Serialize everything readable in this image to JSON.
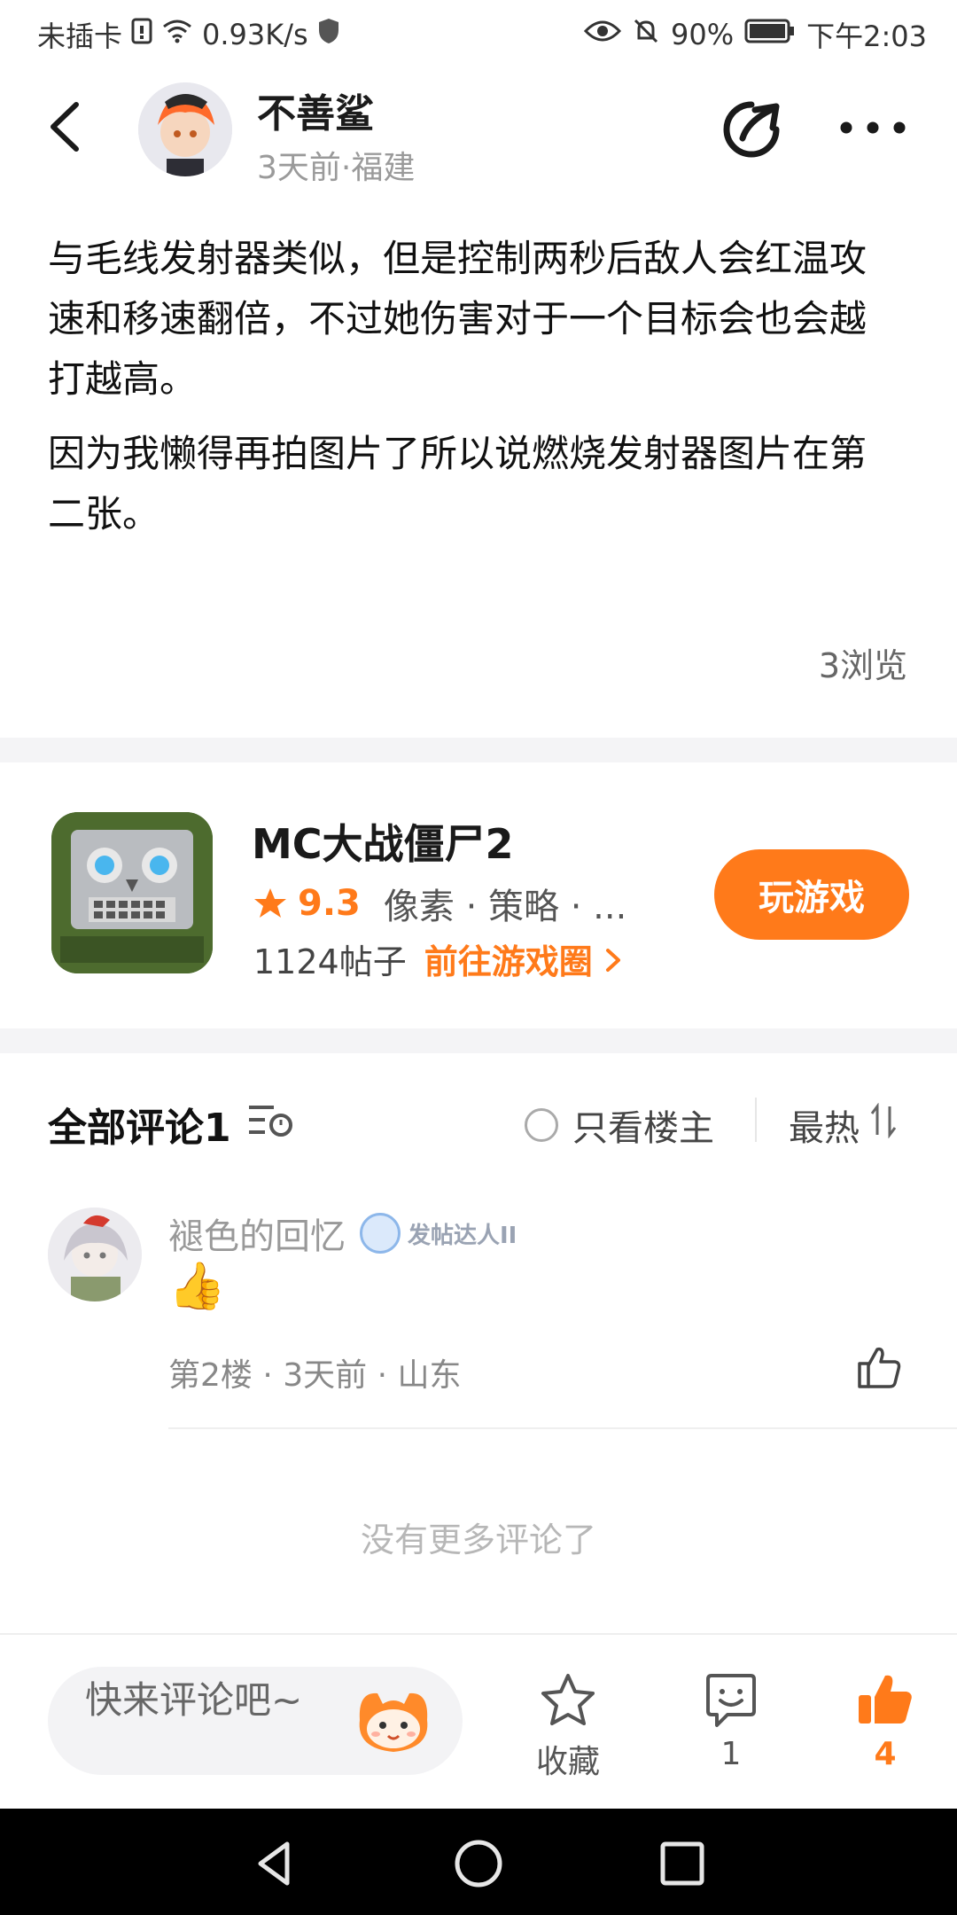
{
  "status_bar": {
    "carrier": "未插卡",
    "speed": "0.93K/s",
    "battery": "90%",
    "time": "下午2:03"
  },
  "header": {
    "author_name": "不善鲨",
    "author_meta": "3天前·福建"
  },
  "post": {
    "paragraphs": [
      "与毛线发射器类似，但是控制两秒后敌人会红温攻速和移速翻倍，不过她伤害对于一个目标会也会越打越高。",
      "因为我懒得再拍图片了所以说燃烧发射器图片在第二张。"
    ],
    "views": "3浏览"
  },
  "game": {
    "title": "MC大战僵尸2",
    "rating": "9.3",
    "tags": "像素 · 策略 · ...",
    "posts": "1124帖子",
    "goto_label": "前往游戏圈",
    "play_label": "玩游戏"
  },
  "comments": {
    "title": "全部评论1",
    "only_op_label": "只看楼主",
    "sort_label": "最热",
    "items": [
      {
        "user": "褪色的回忆",
        "badge": "发帖达人II",
        "content": "👍",
        "meta": "第2楼 · 3天前 · 山东"
      }
    ],
    "no_more": "没有更多评论了"
  },
  "bottom_bar": {
    "input_placeholder": "快来评论吧~",
    "favorite_label": "收藏",
    "comment_count": "1",
    "like_count": "4"
  },
  "colors": {
    "accent": "#ff7a1a",
    "text_primary": "#1a1a1a",
    "text_secondary": "#999999"
  }
}
